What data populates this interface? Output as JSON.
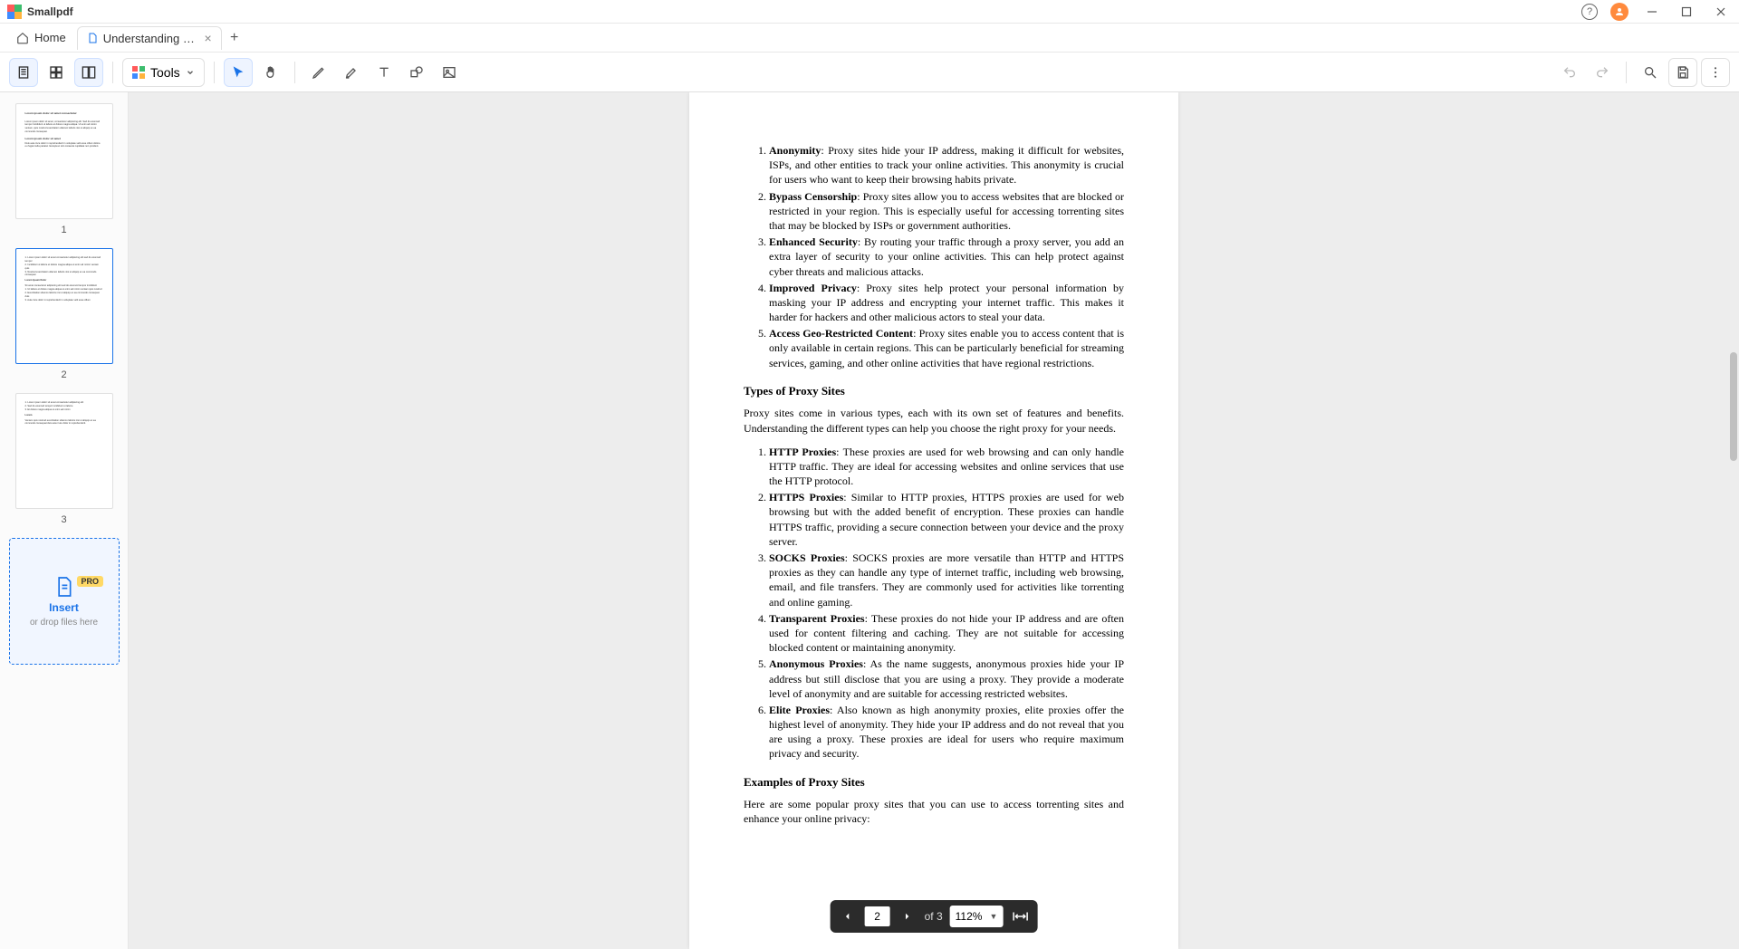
{
  "app": {
    "name": "Smallpdf"
  },
  "tabs": {
    "home": "Home",
    "doc": "Understanding Proxy…"
  },
  "toolbar": {
    "tools_label": "Tools"
  },
  "thumbnails": {
    "n1": "1",
    "n2": "2",
    "n3": "3",
    "insert_label": "Insert",
    "pro_label": "PRO",
    "drop_label": "or drop files here"
  },
  "page": {
    "list1": [
      {
        "bold": "Anonymity",
        "text": ": Proxy sites hide your IP address, making it difficult for websites, ISPs, and other entities to track your online activities. This anonymity is crucial for users who want to keep their browsing habits private."
      },
      {
        "bold": "Bypass Censorship",
        "text": ": Proxy sites allow you to access websites that are blocked or restricted in your region. This is especially useful for accessing torrenting sites that may be blocked by ISPs or government authorities."
      },
      {
        "bold": "Enhanced Security",
        "text": ": By routing your traffic through a proxy server, you add an extra layer of security to your online activities. This can help protect against cyber threats and malicious attacks."
      },
      {
        "bold": "Improved Privacy",
        "text": ": Proxy sites help protect your personal information by masking your IP address and encrypting your internet traffic. This makes it harder for hackers and other malicious actors to steal your data."
      },
      {
        "bold": "Access Geo-Restricted Content",
        "text": ": Proxy sites enable you to access content that is only available in certain regions. This can be particularly beneficial for streaming services, gaming, and other online activities that have regional restrictions."
      }
    ],
    "heading1": "Types of Proxy Sites",
    "para1": "Proxy sites come in various types, each with its own set of features and benefits. Understanding the different types can help you choose the right proxy for your needs.",
    "list2": [
      {
        "bold": "HTTP Proxies",
        "text": ": These proxies are used for web browsing and can only handle HTTP traffic. They are ideal for accessing websites and online services that use the HTTP protocol."
      },
      {
        "bold": "HTTPS Proxies",
        "text": ": Similar to HTTP proxies, HTTPS proxies are used for web browsing but with the added benefit of encryption. These proxies can handle HTTPS traffic, providing a secure connection between your device and the proxy server."
      },
      {
        "bold": "SOCKS Proxies",
        "text": ": SOCKS proxies are more versatile than HTTP and HTTPS proxies as they can handle any type of internet traffic, including web browsing, email, and file transfers. They are commonly used for activities like torrenting and online gaming."
      },
      {
        "bold": "Transparent Proxies",
        "text": ": These proxies do not hide your IP address and are often used for content filtering and caching. They are not suitable for accessing blocked content or maintaining anonymity."
      },
      {
        "bold": "Anonymous Proxies",
        "text": ": As the name suggests, anonymous proxies hide your IP address but still disclose that you are using a proxy. They provide a moderate level of anonymity and are suitable for accessing restricted websites."
      },
      {
        "bold": "Elite Proxies",
        "text": ": Also known as high anonymity proxies, elite proxies offer the highest level of anonymity. They hide your IP address and do not reveal that you are using a proxy. These proxies are ideal for users who require maximum privacy and security."
      }
    ],
    "heading2": "Examples of Proxy Sites",
    "para2": "Here are some popular proxy sites that you can use to access torrenting sites and enhance your online privacy:"
  },
  "pager": {
    "current": "2",
    "of_label": "of 3",
    "zoom": "112%"
  }
}
